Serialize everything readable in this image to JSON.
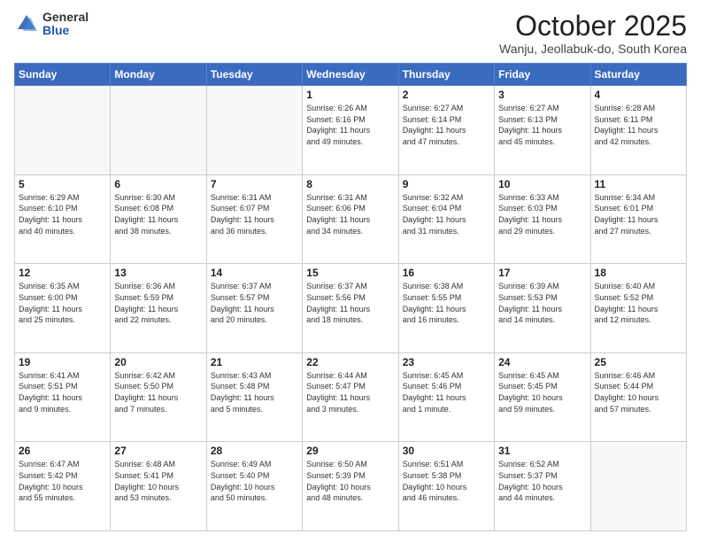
{
  "header": {
    "logo_general": "General",
    "logo_blue": "Blue",
    "month_title": "October 2025",
    "location": "Wanju, Jeollabuk-do, South Korea"
  },
  "days_of_week": [
    "Sunday",
    "Monday",
    "Tuesday",
    "Wednesday",
    "Thursday",
    "Friday",
    "Saturday"
  ],
  "weeks": [
    [
      {
        "num": "",
        "info": ""
      },
      {
        "num": "",
        "info": ""
      },
      {
        "num": "",
        "info": ""
      },
      {
        "num": "1",
        "info": "Sunrise: 6:26 AM\nSunset: 6:16 PM\nDaylight: 11 hours\nand 49 minutes."
      },
      {
        "num": "2",
        "info": "Sunrise: 6:27 AM\nSunset: 6:14 PM\nDaylight: 11 hours\nand 47 minutes."
      },
      {
        "num": "3",
        "info": "Sunrise: 6:27 AM\nSunset: 6:13 PM\nDaylight: 11 hours\nand 45 minutes."
      },
      {
        "num": "4",
        "info": "Sunrise: 6:28 AM\nSunset: 6:11 PM\nDaylight: 11 hours\nand 42 minutes."
      }
    ],
    [
      {
        "num": "5",
        "info": "Sunrise: 6:29 AM\nSunset: 6:10 PM\nDaylight: 11 hours\nand 40 minutes."
      },
      {
        "num": "6",
        "info": "Sunrise: 6:30 AM\nSunset: 6:08 PM\nDaylight: 11 hours\nand 38 minutes."
      },
      {
        "num": "7",
        "info": "Sunrise: 6:31 AM\nSunset: 6:07 PM\nDaylight: 11 hours\nand 36 minutes."
      },
      {
        "num": "8",
        "info": "Sunrise: 6:31 AM\nSunset: 6:06 PM\nDaylight: 11 hours\nand 34 minutes."
      },
      {
        "num": "9",
        "info": "Sunrise: 6:32 AM\nSunset: 6:04 PM\nDaylight: 11 hours\nand 31 minutes."
      },
      {
        "num": "10",
        "info": "Sunrise: 6:33 AM\nSunset: 6:03 PM\nDaylight: 11 hours\nand 29 minutes."
      },
      {
        "num": "11",
        "info": "Sunrise: 6:34 AM\nSunset: 6:01 PM\nDaylight: 11 hours\nand 27 minutes."
      }
    ],
    [
      {
        "num": "12",
        "info": "Sunrise: 6:35 AM\nSunset: 6:00 PM\nDaylight: 11 hours\nand 25 minutes."
      },
      {
        "num": "13",
        "info": "Sunrise: 6:36 AM\nSunset: 5:59 PM\nDaylight: 11 hours\nand 22 minutes."
      },
      {
        "num": "14",
        "info": "Sunrise: 6:37 AM\nSunset: 5:57 PM\nDaylight: 11 hours\nand 20 minutes."
      },
      {
        "num": "15",
        "info": "Sunrise: 6:37 AM\nSunset: 5:56 PM\nDaylight: 11 hours\nand 18 minutes."
      },
      {
        "num": "16",
        "info": "Sunrise: 6:38 AM\nSunset: 5:55 PM\nDaylight: 11 hours\nand 16 minutes."
      },
      {
        "num": "17",
        "info": "Sunrise: 6:39 AM\nSunset: 5:53 PM\nDaylight: 11 hours\nand 14 minutes."
      },
      {
        "num": "18",
        "info": "Sunrise: 6:40 AM\nSunset: 5:52 PM\nDaylight: 11 hours\nand 12 minutes."
      }
    ],
    [
      {
        "num": "19",
        "info": "Sunrise: 6:41 AM\nSunset: 5:51 PM\nDaylight: 11 hours\nand 9 minutes."
      },
      {
        "num": "20",
        "info": "Sunrise: 6:42 AM\nSunset: 5:50 PM\nDaylight: 11 hours\nand 7 minutes."
      },
      {
        "num": "21",
        "info": "Sunrise: 6:43 AM\nSunset: 5:48 PM\nDaylight: 11 hours\nand 5 minutes."
      },
      {
        "num": "22",
        "info": "Sunrise: 6:44 AM\nSunset: 5:47 PM\nDaylight: 11 hours\nand 3 minutes."
      },
      {
        "num": "23",
        "info": "Sunrise: 6:45 AM\nSunset: 5:46 PM\nDaylight: 11 hours\nand 1 minute."
      },
      {
        "num": "24",
        "info": "Sunrise: 6:45 AM\nSunset: 5:45 PM\nDaylight: 10 hours\nand 59 minutes."
      },
      {
        "num": "25",
        "info": "Sunrise: 6:46 AM\nSunset: 5:44 PM\nDaylight: 10 hours\nand 57 minutes."
      }
    ],
    [
      {
        "num": "26",
        "info": "Sunrise: 6:47 AM\nSunset: 5:42 PM\nDaylight: 10 hours\nand 55 minutes."
      },
      {
        "num": "27",
        "info": "Sunrise: 6:48 AM\nSunset: 5:41 PM\nDaylight: 10 hours\nand 53 minutes."
      },
      {
        "num": "28",
        "info": "Sunrise: 6:49 AM\nSunset: 5:40 PM\nDaylight: 10 hours\nand 50 minutes."
      },
      {
        "num": "29",
        "info": "Sunrise: 6:50 AM\nSunset: 5:39 PM\nDaylight: 10 hours\nand 48 minutes."
      },
      {
        "num": "30",
        "info": "Sunrise: 6:51 AM\nSunset: 5:38 PM\nDaylight: 10 hours\nand 46 minutes."
      },
      {
        "num": "31",
        "info": "Sunrise: 6:52 AM\nSunset: 5:37 PM\nDaylight: 10 hours\nand 44 minutes."
      },
      {
        "num": "",
        "info": ""
      }
    ]
  ]
}
